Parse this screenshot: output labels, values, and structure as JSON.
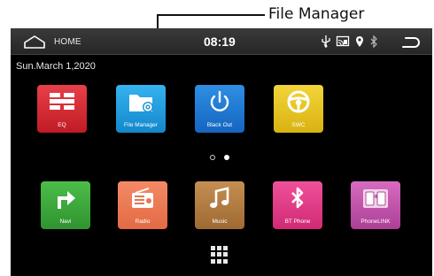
{
  "callout": {
    "label": "File Manager"
  },
  "statusbar": {
    "home_label": "HOME",
    "time": "08:19",
    "icons": [
      "usb-icon",
      "screen-mirror-icon",
      "location-icon",
      "bluetooth-icon"
    ],
    "back_icon": "back-arrow-icon"
  },
  "date": "Sun.March 1,2020",
  "page1_apps": [
    {
      "label": "EQ",
      "icon": "equalizer-icon",
      "color": "#d8262f"
    },
    {
      "label": "File Manager",
      "icon": "folder-gear-icon",
      "color": "#1d9ee0"
    },
    {
      "label": "Black Out",
      "icon": "power-icon",
      "color": "#1f7fd6"
    },
    {
      "label": "SWC",
      "icon": "steering-wheel-icon",
      "color": "#e5c31d"
    }
  ],
  "pager": {
    "pages": 2,
    "active": 2
  },
  "dock_apps": [
    {
      "label": "Navi",
      "icon": "turn-arrow-icon",
      "color": "#3faa3c"
    },
    {
      "label": "Radio",
      "icon": "radio-icon",
      "color": "#ee7a55"
    },
    {
      "label": "Music",
      "icon": "music-note-icon",
      "color": "#b47b3f"
    },
    {
      "label": "BT Phone",
      "icon": "bluetooth-phone-icon",
      "color": "#e43b8a"
    },
    {
      "label": "PhoneLINK",
      "icon": "phone-link-icon",
      "color": "#c255a8"
    }
  ],
  "app_drawer_icon": "app-grid-icon"
}
